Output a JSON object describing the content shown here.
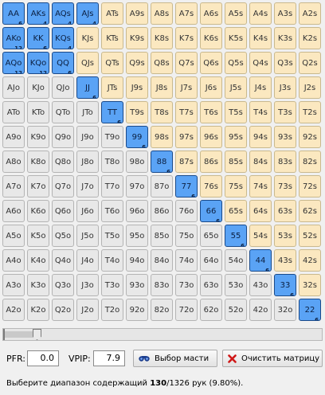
{
  "ranks": [
    "A",
    "K",
    "Q",
    "J",
    "T",
    "9",
    "8",
    "7",
    "6",
    "5",
    "4",
    "3",
    "2"
  ],
  "selected": [
    {
      "hand": "AA",
      "count": "6"
    },
    {
      "hand": "AKs",
      "count": "4"
    },
    {
      "hand": "AQs",
      "count": "4"
    },
    {
      "hand": "AJs",
      "count": "4"
    },
    {
      "hand": "AKo",
      "count": "12"
    },
    {
      "hand": "KK",
      "count": "6"
    },
    {
      "hand": "KQs",
      "count": "4"
    },
    {
      "hand": "AQo",
      "count": "12"
    },
    {
      "hand": "KQo",
      "count": "12"
    },
    {
      "hand": "QQ",
      "count": "6"
    },
    {
      "hand": "JJ",
      "count": "6"
    },
    {
      "hand": "TT",
      "count": "6"
    },
    {
      "hand": "99",
      "count": "6"
    },
    {
      "hand": "88",
      "count": "6"
    },
    {
      "hand": "77",
      "count": "6"
    },
    {
      "hand": "66",
      "count": "6"
    },
    {
      "hand": "55",
      "count": "6"
    },
    {
      "hand": "44",
      "count": "6"
    },
    {
      "hand": "33",
      "count": "6"
    },
    {
      "hand": "22",
      "count": "6"
    }
  ],
  "slider": {
    "level_fraction": 0.1
  },
  "controls": {
    "pfr_label": "PFR:",
    "pfr_value": "0.0",
    "vpip_label": "VPIP:",
    "vpip_value": "7.9",
    "suit_button": "Выбор масти",
    "clear_button": "Очистить матрицу"
  },
  "status": {
    "prefix": "Выберите диапазон содержащий ",
    "count": "130",
    "suffix": "/1326 рук (9.80%)."
  }
}
